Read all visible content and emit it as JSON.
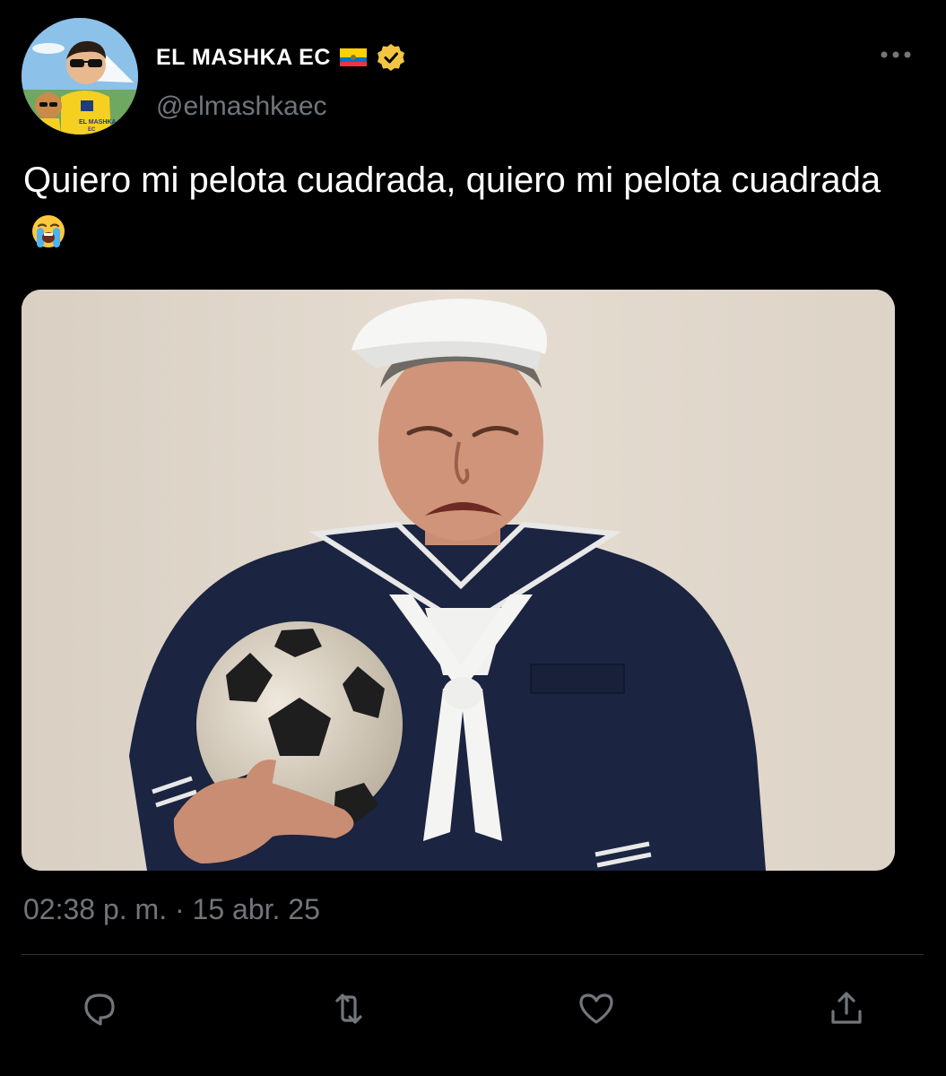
{
  "account": {
    "display_name": "EL MASHKA EC",
    "handle": "@elmashkaec",
    "verified": true,
    "flag_icon": "ecuador-flag-icon",
    "verified_icon": "verified-badge-icon",
    "avatar_text_line1": "EL MASHKA",
    "avatar_text_line2": "EC"
  },
  "tweet": {
    "text": "Quiero mi pelota cuadrada, quiero mi pelota cuadrada",
    "emoji_icon": "loudly-crying-face-icon",
    "timestamp": "02:38 p. m. · 15 abr. 25"
  },
  "actions": [
    {
      "name": "reply",
      "icon": "reply-icon"
    },
    {
      "name": "retweet",
      "icon": "retweet-icon"
    },
    {
      "name": "like",
      "icon": "heart-icon"
    },
    {
      "name": "share",
      "icon": "share-icon"
    }
  ],
  "colors": {
    "background": "#000000",
    "primary_text": "#ffffff",
    "secondary_text": "#71767b",
    "divider": "#2f3336",
    "verified_badge": "#f4c542"
  }
}
